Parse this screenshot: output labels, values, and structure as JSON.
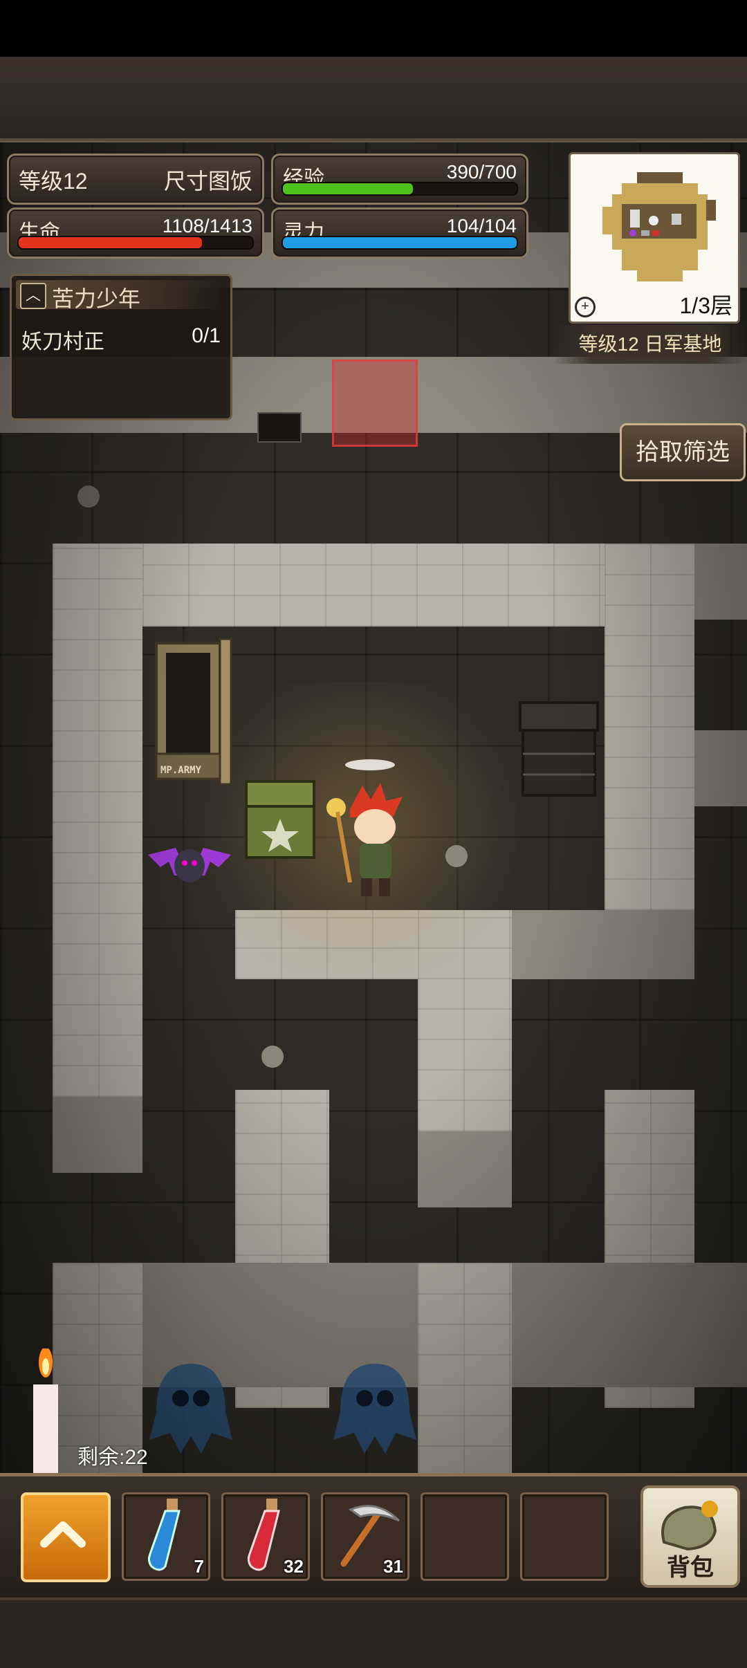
{
  "hud": {
    "level": "等级12",
    "player_name": "尺寸图饭",
    "exp": {
      "label": "经验",
      "value": "390/700",
      "fraction": 0.557,
      "color": "#4fc11b"
    },
    "hp": {
      "label": "生命",
      "value": "1108/1413",
      "fraction": 0.784,
      "color": "#e3321d"
    },
    "mp": {
      "label": "灵力",
      "value": "104/104",
      "fraction": 1.0,
      "color": "#1f9be6"
    }
  },
  "minimap": {
    "floor": "1/3层",
    "zoom_icon": "magnifier-plus-icon"
  },
  "location": "等级12 日军基地",
  "quest": {
    "title": "苦力少年",
    "task": "妖刀村正",
    "progress": "0/1"
  },
  "pickup_filter_label": "拾取筛选",
  "candle": {
    "remaining": "剩余:22"
  },
  "toolbar": {
    "menu_icon": "chevron-up-icon",
    "slots": [
      {
        "item": "blue-potion",
        "count": "7"
      },
      {
        "item": "red-potion",
        "count": "32"
      },
      {
        "item": "pickaxe",
        "count": "31"
      },
      {
        "item": "empty",
        "count": ""
      },
      {
        "item": "empty",
        "count": ""
      }
    ],
    "bag_label": "背包"
  },
  "scene": {
    "crate_label": "MP.ARMY",
    "colors": {
      "wall": "#b8b3a8",
      "floor": "#2f2c27",
      "accent": "#c9b08a"
    }
  }
}
